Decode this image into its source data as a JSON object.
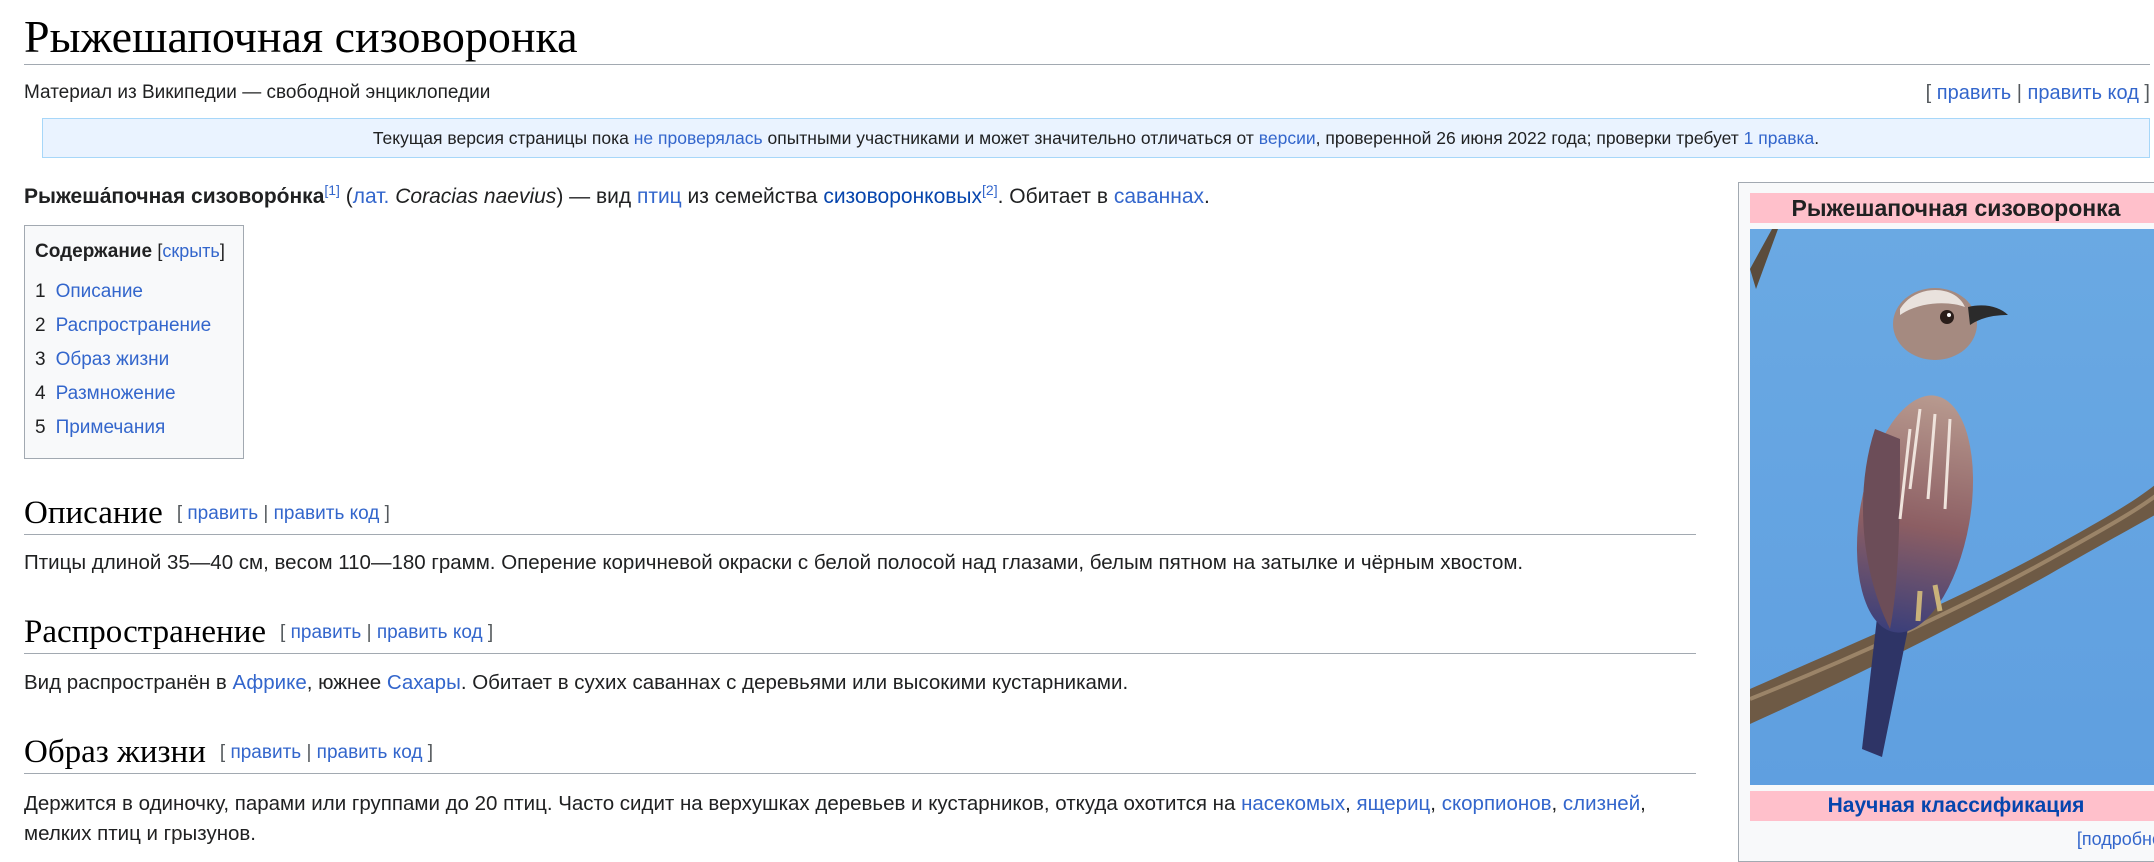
{
  "article": {
    "title": "Рыжешапочная сизоворонка",
    "subtitle": "Материал из Википедии — свободной энциклопедии",
    "edit_links": {
      "open": "[ ",
      "edit": "править",
      "sep": " | ",
      "edit_source": "править код",
      "close": " ]"
    }
  },
  "flagged_revs": {
    "text_1": "Текущая версия страницы пока ",
    "link_unreviewed": "не проверялась",
    "text_2": " опытными участниками и может значительно отличаться от ",
    "link_version": "версии",
    "text_3": ", проверенной 26 июня 2022 года; проверки требует ",
    "link_edits": "1 правка",
    "text_4": "."
  },
  "lead": {
    "name_bold": "Рыжеша́почная сизоворо́нка",
    "ref1": "[1]",
    "paren_open": " (",
    "lat_link": "лат.",
    "lat_name": " Coracias naevius",
    "paren_close": ") — вид ",
    "link_birds": "птиц",
    "text_family": " из семейства ",
    "link_family": "сизоворонковых",
    "ref2": "[2]",
    "text_habitat": ". Обитает в ",
    "link_savanna": "саваннах",
    "end": "."
  },
  "toc": {
    "title": "Содержание",
    "toggle_open": "[",
    "toggle": "скрыть",
    "toggle_close": "]",
    "items": [
      {
        "num": "1",
        "label": "Описание"
      },
      {
        "num": "2",
        "label": "Распространение"
      },
      {
        "num": "3",
        "label": "Образ жизни"
      },
      {
        "num": "4",
        "label": "Размножение"
      },
      {
        "num": "5",
        "label": "Примечания"
      }
    ]
  },
  "sections": {
    "description": {
      "heading": "Описание",
      "text": "Птицы длиной 35—40 см, весом 110—180 грамм. Оперение коричневой окраски с белой полосой над глазами, белым пятном на затылке и чёрным хвостом."
    },
    "distribution": {
      "heading": "Распространение",
      "text_1": "Вид распространён в ",
      "link_africa": "Африке",
      "text_2": ", южнее ",
      "link_sahara": "Сахары",
      "text_3": ". Обитает в сухих саваннах с деревьями или высокими кустарниками."
    },
    "lifestyle": {
      "heading": "Образ жизни",
      "text_1": "Держится в одиночку, парами или группами до 20 птиц. Часто сидит на верхушках деревьев и кустарников, откуда охотится на ",
      "link_insects": "насекомых",
      "comma": ", ",
      "link_lizards": "ящериц",
      "link_scorpions": "скорпионов",
      "link_snakes": "слизней",
      "end_comma": ",",
      "text_2": "мелких птиц и грызунов."
    }
  },
  "infobox": {
    "title": "Рыжешапочная сизоворонка",
    "classification": "Научная классификация",
    "more": "[подробно]"
  },
  "colors": {
    "link": "#3366cc",
    "infobox_header": "#ffc0cb",
    "flagged_bg": "#eaf3ff",
    "sky": "#6aa9e3"
  }
}
